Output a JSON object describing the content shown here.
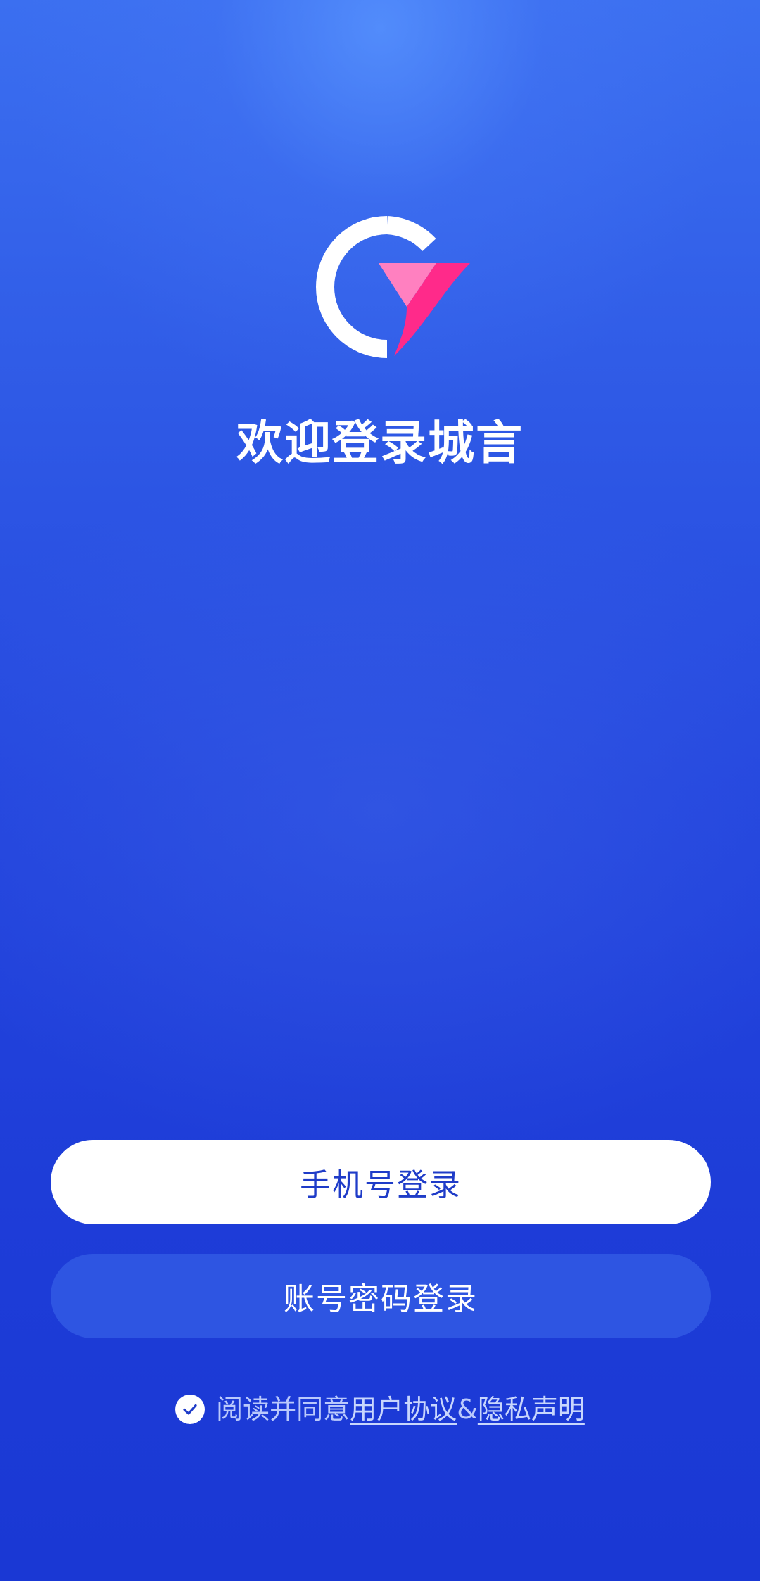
{
  "welcome": {
    "title": "欢迎登录城言"
  },
  "logo": {
    "icon": "chengyan-logo-icon",
    "ring_color": "#ffffff",
    "mark_light_color": "#ff80c0",
    "mark_dark_color": "#ff2a8a"
  },
  "buttons": {
    "phone_login": "手机号登录",
    "account_login": "账号密码登录"
  },
  "agreement": {
    "checked": true,
    "prefix": "阅读并同意",
    "user_agreement": "用户协议",
    "separator": "&",
    "privacy_statement": "隐私声明"
  },
  "colors": {
    "background_top": "#4a80f5",
    "background_bottom": "#1a38d4",
    "phone_button_bg": "#ffffff",
    "phone_button_text": "#1f3cc8",
    "account_button_bg": "#2e55e2"
  }
}
